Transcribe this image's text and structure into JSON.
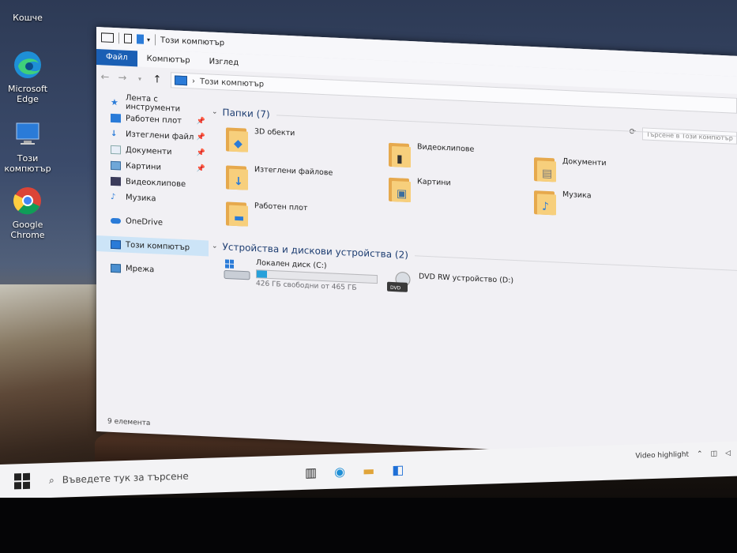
{
  "desktop": {
    "icons": [
      {
        "label": "Кошче"
      },
      {
        "label": "Microsoft Edge"
      },
      {
        "label": "Този компютър"
      },
      {
        "label": "Google Chrome"
      }
    ]
  },
  "window": {
    "title": "Този компютър",
    "ribbon_tabs": [
      "Файл",
      "Компютър",
      "Изглед"
    ],
    "address": {
      "separator": "›",
      "location": "Този компютър"
    },
    "search_placeholder": "Търсене в Този компютър",
    "sidebar": [
      {
        "label": "Лента с инструменти",
        "icon": "star-icon"
      },
      {
        "label": "Работен плот",
        "icon": "desktop-icon",
        "pinned": true
      },
      {
        "label": "Изтеглени файл",
        "icon": "download-icon",
        "pinned": true
      },
      {
        "label": "Документи",
        "icon": "document-icon",
        "pinned": true
      },
      {
        "label": "Картини",
        "icon": "pictures-icon",
        "pinned": true
      },
      {
        "label": "Видеоклипове",
        "icon": "video-icon"
      },
      {
        "label": "Музика",
        "icon": "music-icon"
      },
      {
        "label": "OneDrive",
        "icon": "cloud-icon"
      },
      {
        "label": "Този компютър",
        "icon": "computer-icon",
        "selected": true
      },
      {
        "label": "Мрежа",
        "icon": "network-icon"
      }
    ],
    "folders_group": "Папки (7)",
    "folders": [
      {
        "name": "3D обекти",
        "icon": "3d-objects-icon"
      },
      {
        "name": "Видеоклипове",
        "icon": "video-icon"
      },
      {
        "name": "Документи",
        "icon": "document-icon"
      },
      {
        "name": "Изтеглени файлове",
        "icon": "download-icon"
      },
      {
        "name": "Картини",
        "icon": "pictures-icon"
      },
      {
        "name": "Музика",
        "icon": "music-icon"
      },
      {
        "name": "Работен плот",
        "icon": "desktop-icon"
      }
    ],
    "devices_group": "Устройства и дискови устройства (2)",
    "devices": [
      {
        "name": "Локален диск (C:)",
        "free": "426 ГБ свободни от 465 ГБ",
        "used_fraction": 0.084
      },
      {
        "name": "DVD RW устройство (D:)"
      }
    ],
    "status": "9 елемента"
  },
  "taskbar": {
    "search_placeholder": "Въведете тук за търсене",
    "tray_text": "Video highlight"
  },
  "colors": {
    "accent": "#1a5fb4",
    "folder": "#f7cf7c",
    "drive_bar": "#26a0da"
  }
}
